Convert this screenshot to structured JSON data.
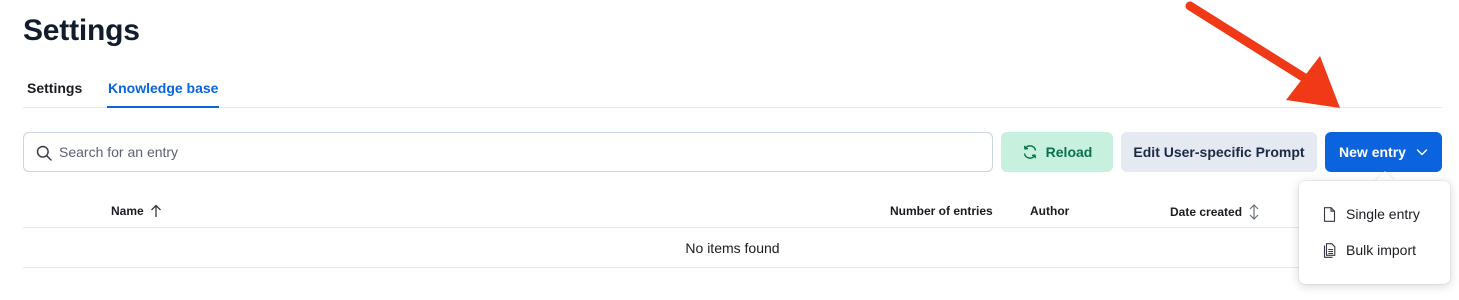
{
  "page": {
    "title": "Settings"
  },
  "tabs": [
    {
      "label": "Settings",
      "active": false
    },
    {
      "label": "Knowledge base",
      "active": true
    }
  ],
  "search": {
    "placeholder": "Search for an entry",
    "value": "",
    "icon": "search-icon"
  },
  "toolbar": {
    "reload_label": "Reload",
    "reload_icon": "refresh-icon",
    "prompt_label": "Edit User-specific Prompt",
    "new_entry_label": "New entry",
    "new_entry_icon": "chevron-down-icon"
  },
  "table": {
    "columns": [
      {
        "label": "Name",
        "sort": "ascending"
      },
      {
        "label": "Number of entries",
        "sort": "none"
      },
      {
        "label": "Author",
        "sort": "none"
      },
      {
        "label": "Date created",
        "sort": "sortable"
      }
    ],
    "empty_message": "No items found"
  },
  "new_entry_menu": {
    "items": [
      {
        "label": "Single entry",
        "icon": "document-icon"
      },
      {
        "label": "Bulk import",
        "icon": "documents-icon"
      }
    ]
  },
  "annotation": {
    "arrow_color": "#f03a17"
  },
  "colors": {
    "primary": "#0b64dd",
    "success_bg": "#c7f0df",
    "success_text": "#09724d",
    "neutral_bg": "#e5e9f2",
    "heading": "#111c2c"
  }
}
